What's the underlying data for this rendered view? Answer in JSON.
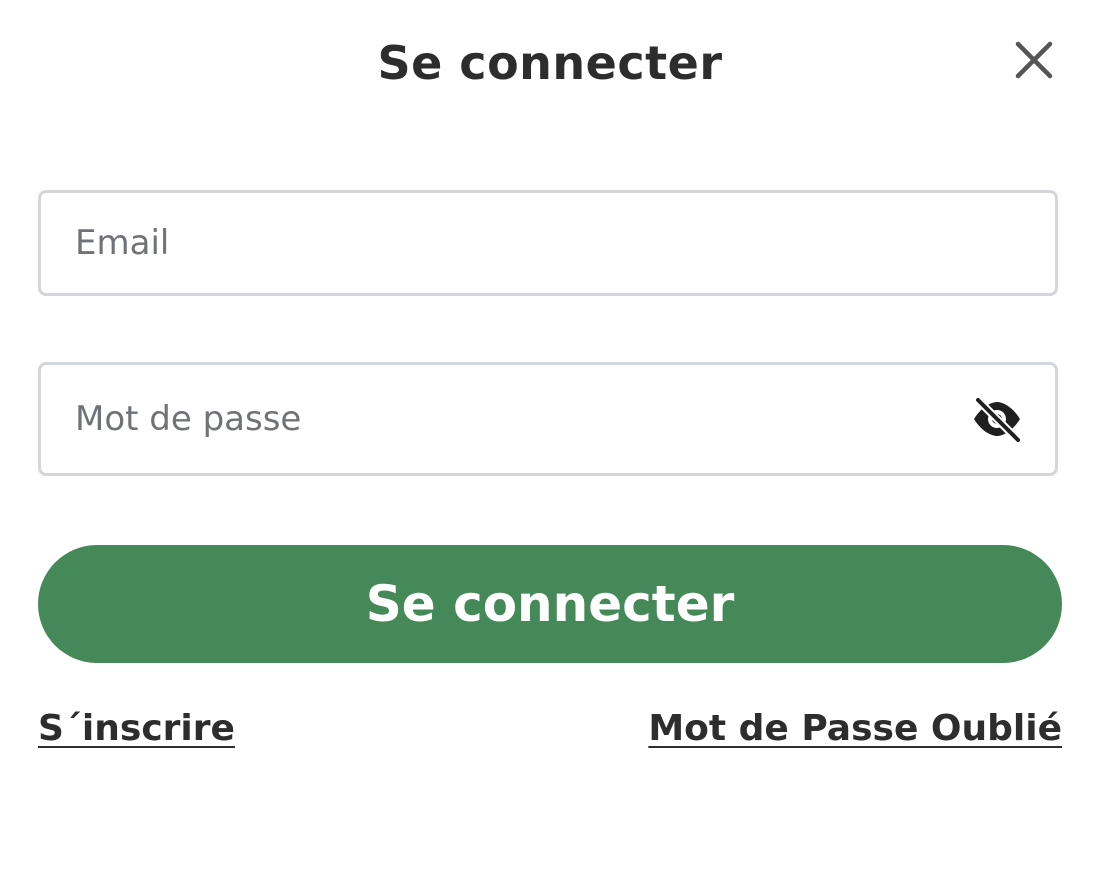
{
  "modal": {
    "title": "Se connecter",
    "close_icon": "close-icon"
  },
  "form": {
    "email": {
      "placeholder": "Email",
      "value": ""
    },
    "password": {
      "placeholder": "Mot de passe",
      "value": "",
      "toggle_icon": "eye-slash-icon"
    },
    "submit_label": "Se connecter"
  },
  "links": {
    "signup": "S´inscrire",
    "forgot_password": "Mot de Passe Oublié"
  },
  "colors": {
    "primary_button": "#458958",
    "text": "#2d2d2d",
    "input_border": "#d3d6da",
    "placeholder": "#6f7378"
  }
}
